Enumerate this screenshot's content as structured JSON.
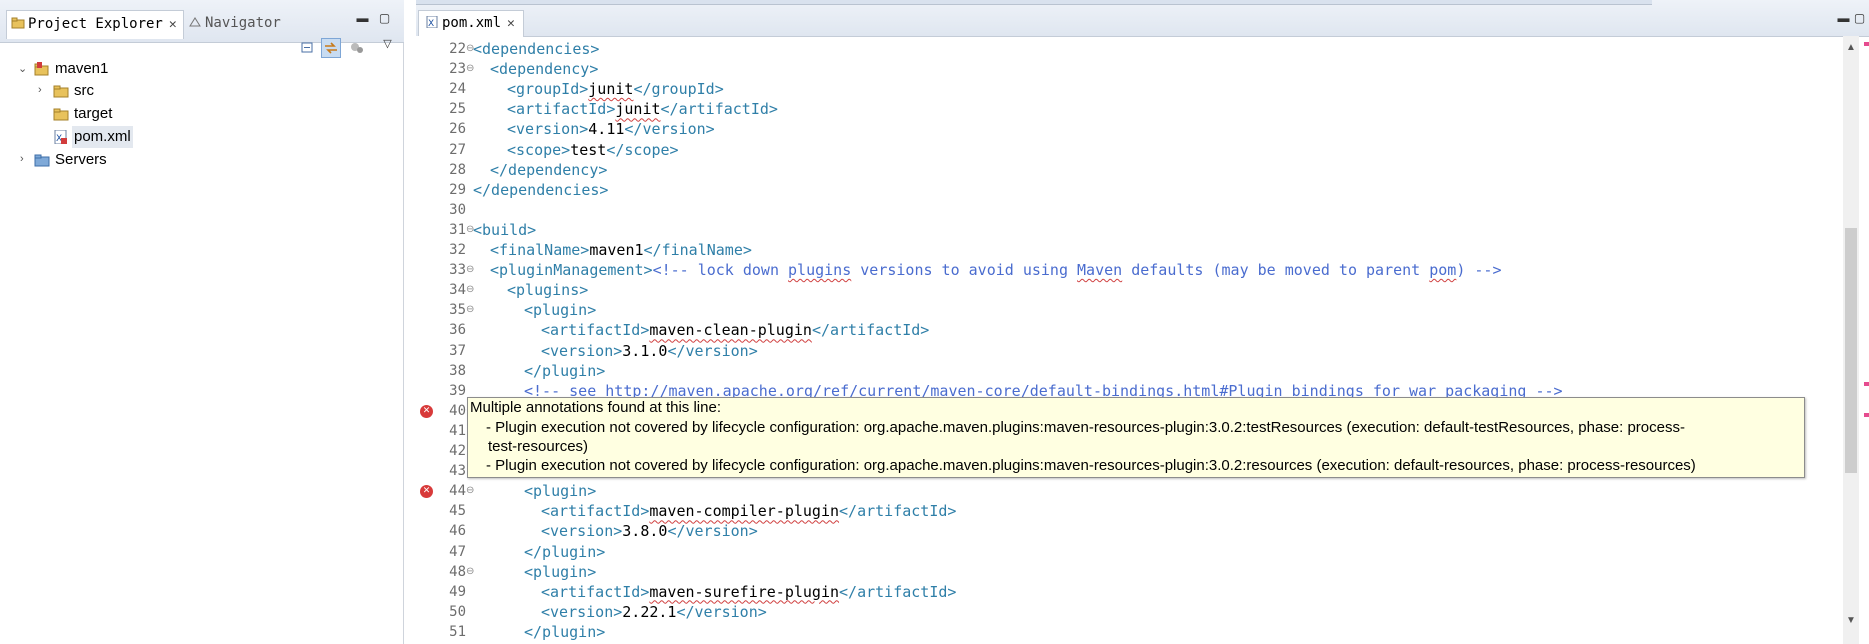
{
  "left_panel": {
    "tabs": [
      {
        "label": "Project Explorer",
        "icon": "project-explorer-icon",
        "active": true
      },
      {
        "label": "Navigator",
        "icon": "navigator-icon",
        "active": false
      }
    ],
    "tree": [
      {
        "label": "maven1",
        "icon": "maven-project-icon",
        "expanded": true
      },
      {
        "label": "src",
        "icon": "folder-icon",
        "expanded": false
      },
      {
        "label": "target",
        "icon": "folder-icon"
      },
      {
        "label": "pom.xml",
        "icon": "xml-file-icon",
        "selected": true
      },
      {
        "label": "Servers",
        "icon": "servers-folder-icon",
        "expanded": false
      }
    ]
  },
  "editor": {
    "tab_label": "pom.xml",
    "lines": [
      {
        "n": "22",
        "fold": true
      },
      {
        "n": "23",
        "fold": true
      },
      {
        "n": "24"
      },
      {
        "n": "25"
      },
      {
        "n": "26"
      },
      {
        "n": "27"
      },
      {
        "n": "28"
      },
      {
        "n": "29"
      },
      {
        "n": "30"
      },
      {
        "n": "31",
        "fold": true
      },
      {
        "n": "32"
      },
      {
        "n": "33",
        "fold": true
      },
      {
        "n": "34",
        "fold": true
      },
      {
        "n": "35",
        "fold": true
      },
      {
        "n": "36"
      },
      {
        "n": "37"
      },
      {
        "n": "38"
      },
      {
        "n": "39"
      },
      {
        "n": "40",
        "fold": true,
        "error": true
      },
      {
        "n": "41"
      },
      {
        "n": "42"
      },
      {
        "n": "43"
      },
      {
        "n": "44",
        "fold": true,
        "error": true
      },
      {
        "n": "45"
      },
      {
        "n": "46"
      },
      {
        "n": "47"
      },
      {
        "n": "48",
        "fold": true
      },
      {
        "n": "49"
      },
      {
        "n": "50"
      },
      {
        "n": "51"
      }
    ],
    "code": {
      "l22": [
        "<dependencies>"
      ],
      "l23": [
        "<dependency>"
      ],
      "l24": [
        "<groupId>",
        "junit",
        "</groupId>"
      ],
      "l25": [
        "<artifactId>",
        "junit",
        "</artifactId>"
      ],
      "l26": [
        "<version>",
        "4.11",
        "</version>"
      ],
      "l27": [
        "<scope>",
        "test",
        "</scope>"
      ],
      "l28": [
        "</dependency>"
      ],
      "l29": [
        "</dependencies>"
      ],
      "l31": [
        "<build>"
      ],
      "l32": [
        "<finalName>",
        "maven1",
        "</finalName>"
      ],
      "l33": [
        "<pluginManagement>",
        "<!-- lock down ",
        "plugins",
        " versions to avoid using ",
        "Maven",
        " defaults (may be moved to parent ",
        "pom",
        ") -->"
      ],
      "l34": [
        "<plugins>"
      ],
      "l35": [
        "<plugin>"
      ],
      "l36": [
        "<artifactId>",
        "maven-clean-plugin",
        "</artifactId>"
      ],
      "l37": [
        "<version>",
        "3.1.0",
        "</version>"
      ],
      "l38": [
        "</plugin>"
      ],
      "l39": [
        "<!-- see http://maven.apache.org/ref/current/maven-core/default-bindings.html#Plugin_bindings_for_war_packaging -->"
      ],
      "l44": [
        "<plugin>"
      ],
      "l45": [
        "<artifactId>",
        "maven-compiler-plugin",
        "</artifactId>"
      ],
      "l46": [
        "<version>",
        "3.8.0",
        "</version>"
      ],
      "l47": [
        "</plugin>"
      ],
      "l48": [
        "<plugin>"
      ],
      "l49": [
        "<artifactId>",
        "maven-surefire-plugin",
        "</artifactId>"
      ],
      "l50": [
        "<version>",
        "2.22.1",
        "</version>"
      ],
      "l51": [
        "</plugin>"
      ]
    },
    "tooltip": {
      "title": "Multiple annotations found at this line:",
      "item1_a": "- Plugin execution not covered by lifecycle configuration: org.apache.maven.plugins:maven-resources-plugin:3.0.2:testResources (execution: default-testResources, phase: process-",
      "item1_b": "test-resources)",
      "item2": "- Plugin execution not covered by lifecycle configuration: org.apache.maven.plugins:maven-resources-plugin:3.0.2:resources (execution: default-resources, phase: process-resources)"
    }
  },
  "colors": {
    "tag": "#2f7fa8",
    "comment": "#4a6ccf",
    "error": "#d83a3a",
    "tooltip_bg": "#ffffe1"
  }
}
